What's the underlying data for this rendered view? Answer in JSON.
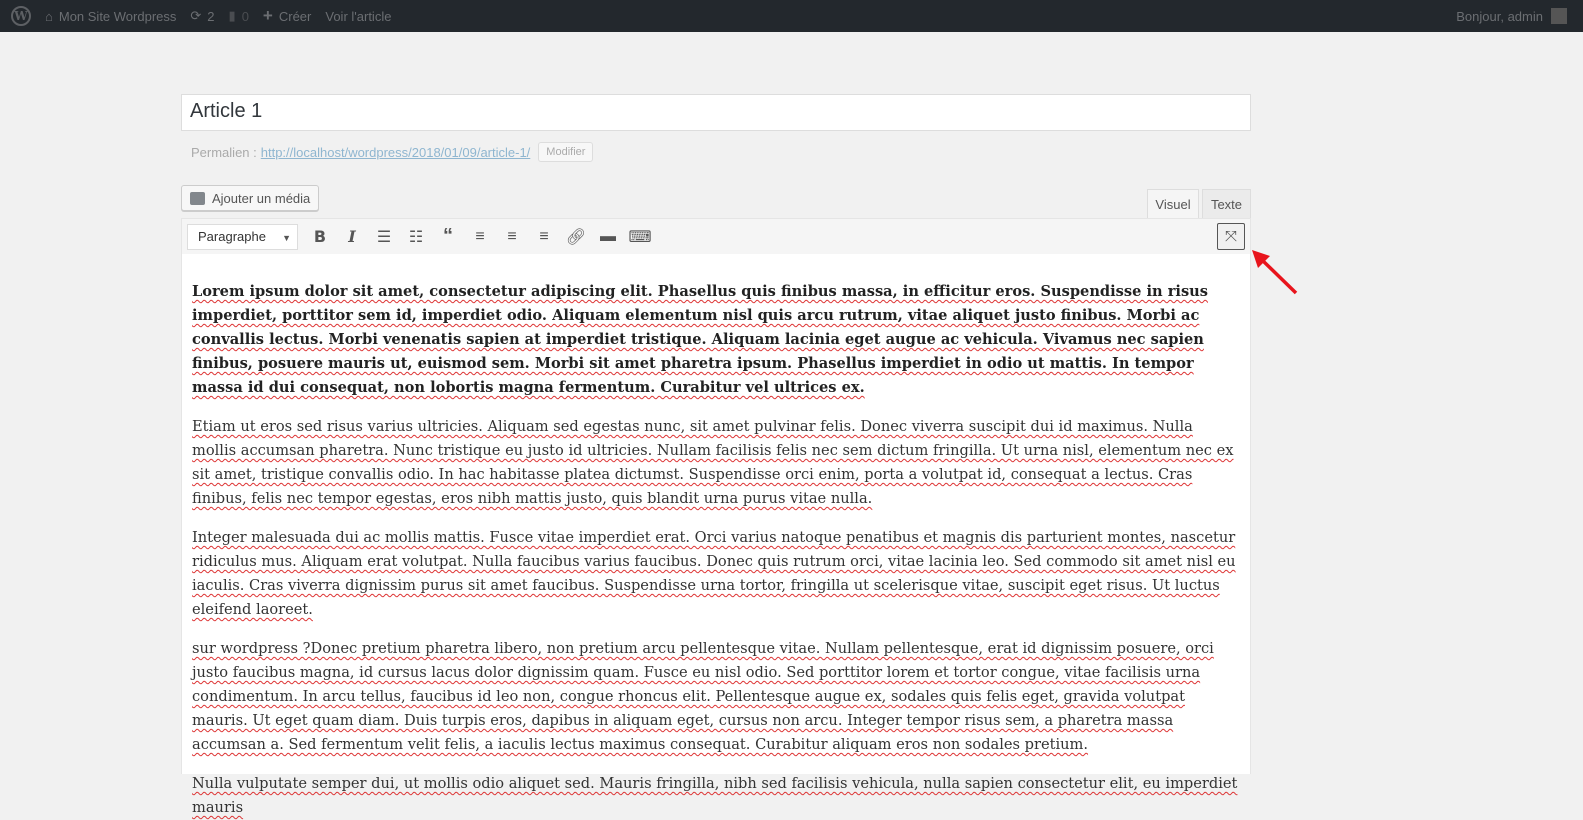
{
  "adminbar": {
    "site_name": "Mon Site Wordpress",
    "updates_count": "2",
    "comments_count": "0",
    "new_label": "Créer",
    "view_label": "Voir l'article",
    "greeting": "Bonjour, admin"
  },
  "editor": {
    "title": "Article 1",
    "permalink_label": "Permalien :",
    "permalink_url": "http://localhost/wordpress/2018/01/09/article-1/",
    "modify_label": "Modifier",
    "add_media_label": "Ajouter un média",
    "tabs": {
      "visual": "Visuel",
      "text": "Texte"
    },
    "format_select": "Paragraphe",
    "toolbar_icons": [
      "bold-icon",
      "italic-icon",
      "bullet-list-icon",
      "numbered-list-icon",
      "blockquote-icon",
      "align-left-icon",
      "align-center-icon",
      "align-right-icon",
      "link-icon",
      "read-more-icon",
      "toolbar-toggle-icon",
      "fullscreen-icon"
    ],
    "paragraphs": [
      "Lorem ipsum dolor sit amet, consectetur adipiscing elit. Phasellus quis finibus massa, in efficitur eros. Suspendisse in risus imperdiet, porttitor sem id, imperdiet odio. Aliquam elementum nisl quis arcu rutrum, vitae aliquet justo finibus. Morbi ac convallis lectus. Morbi venenatis sapien at imperdiet tristique. Aliquam lacinia eget augue ac vehicula. Vivamus nec sapien finibus, posuere mauris ut, euismod sem. Morbi sit amet pharetra ipsum. Phasellus imperdiet in odio ut mattis. In tempor massa id dui consequat, non lobortis magna fermentum. Curabitur vel ultrices ex.",
      "Etiam ut eros sed risus varius ultricies. Aliquam sed egestas nunc, sit amet pulvinar felis. Donec viverra suscipit dui id maximus. Nulla mollis accumsan pharetra. Nunc tristique eu justo id ultricies. Nullam facilisis felis nec sem dictum fringilla. Ut urna nisl, elementum nec ex sit amet, tristique convallis odio. In hac habitasse platea dictumst. Suspendisse orci enim, porta a volutpat id, consequat a lectus. Cras finibus, felis nec tempor egestas, eros nibh mattis justo, quis blandit urna purus vitae nulla.",
      "Integer malesuada dui ac mollis mattis. Fusce vitae imperdiet erat. Orci varius natoque penatibus et magnis dis parturient montes, nascetur ridiculus mus. Aliquam erat volutpat. Nulla faucibus varius faucibus. Donec quis rutrum orci, vitae lacinia leo. Sed commodo sit amet nisl eu iaculis. Cras viverra dignissim purus sit amet faucibus. Suspendisse urna tortor, fringilla ut scelerisque vitae, suscipit eget risus. Ut luctus eleifend laoreet.",
      "sur wordpress ?Donec pretium pharetra libero, non pretium arcu pellentesque vitae. Nullam pellentesque, erat id dignissim posuere, orci justo faucibus magna, id cursus lacus dolor dignissim quam. Fusce eu nisl odio. Sed porttitor lorem et tortor congue, vitae facilisis urna condimentum. In arcu tellus, faucibus id leo non, congue rhoncus elit. Pellentesque augue ex, sodales quis felis eget, gravida volutpat mauris. Ut eget quam diam. Duis turpis eros, dapibus in aliquam eget, cursus non arcu. Integer tempor risus sem, a pharetra massa accumsan a. Sed fermentum velit felis, a iaculis lectus maximus consequat. Curabitur aliquam eros non sodales pretium.",
      "Nulla vulputate semper dui, ut mollis odio aliquet sed. Mauris fringilla, nibh sed facilisis vehicula, nulla sapien consectetur elit, eu imperdiet mauris"
    ]
  },
  "colors": {
    "adminbar": "#23282d",
    "background": "#f1f1f1",
    "annotation_arrow": "#e8141c",
    "spellcheck": "#dd3333"
  }
}
